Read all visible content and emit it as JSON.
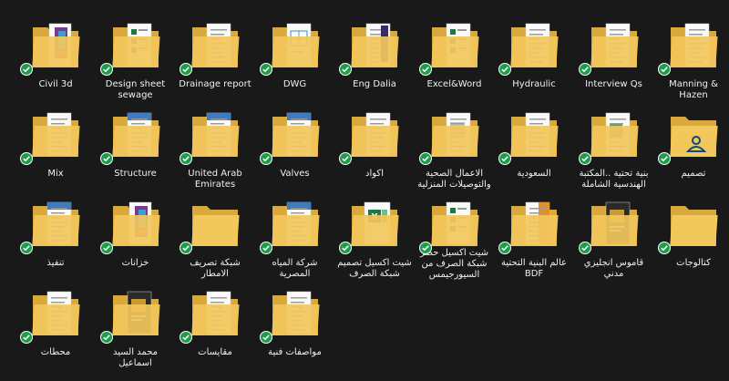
{
  "folders": [
    {
      "label": "Civil 3d",
      "doc": "color"
    },
    {
      "label": "Design sheet sewage",
      "doc": "excel"
    },
    {
      "label": "Drainage report",
      "doc": "text"
    },
    {
      "label": "DWG",
      "doc": "cad"
    },
    {
      "label": "Eng Dalia",
      "doc": "purple"
    },
    {
      "label": "Excel&Word",
      "doc": "excel"
    },
    {
      "label": "Hydraulic",
      "doc": "text"
    },
    {
      "label": "Interview Qs",
      "doc": "text"
    },
    {
      "label": "Manning & Hazen",
      "doc": "text"
    },
    {
      "label": "Mix",
      "doc": "text"
    },
    {
      "label": "Structure",
      "doc": "blue"
    },
    {
      "label": "United Arab Emirates",
      "doc": "blue"
    },
    {
      "label": "Valves",
      "doc": "blue"
    },
    {
      "label": "اكواد",
      "doc": "text"
    },
    {
      "label": "الاعمال الصحية والتوصيلات المنزلية",
      "doc": "gray"
    },
    {
      "label": "السعودية",
      "doc": "text"
    },
    {
      "label": "بنية تحتية ..المكتبة الهندسية الشاملة",
      "doc": "green"
    },
    {
      "label": "تصميم",
      "doc": "user"
    },
    {
      "label": "تنفيذ",
      "doc": "blue"
    },
    {
      "label": "خزانات",
      "doc": "color"
    },
    {
      "label": "شبكة تصريف الامطار",
      "doc": "none"
    },
    {
      "label": "شركة المياه المصرية",
      "doc": "blue"
    },
    {
      "label": "شيت اكسيل تصميم شبكة الصرف",
      "doc": "excelbig"
    },
    {
      "label": "شيت اكسيل حصر شبكة الصرف من السيورجيمس",
      "doc": "excel"
    },
    {
      "label": "عالم البنية التحتية BDF",
      "doc": "orange"
    },
    {
      "label": "قاموس انجليزي مدني",
      "doc": "dark"
    },
    {
      "label": "كتالوجات",
      "doc": "none"
    },
    {
      "label": "محطات",
      "doc": "text"
    },
    {
      "label": "محمد السيد اسماعيل",
      "doc": "dark"
    },
    {
      "label": "مقايسات",
      "doc": "text"
    },
    {
      "label": "مواصفات فنية",
      "doc": "text"
    }
  ],
  "layout_note_colors": {
    "folder_back": "#d9a93b",
    "folder_front": "#f2c75c",
    "check_fill": "#1e9e4a"
  }
}
